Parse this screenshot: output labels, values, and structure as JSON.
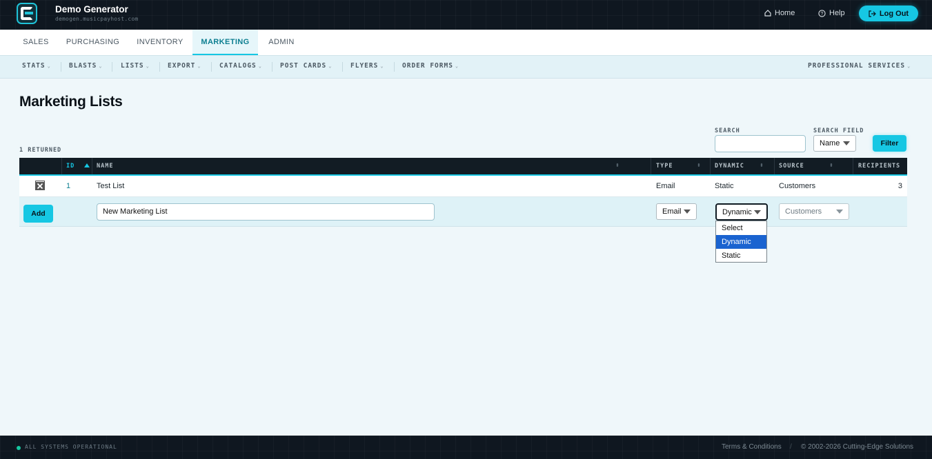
{
  "header": {
    "app_title": "Demo Generator",
    "app_subtitle": "demogen.musicpayhost.com",
    "home_label": "Home",
    "help_label": "Help",
    "logout_label": "Log Out"
  },
  "main_tabs": [
    "SALES",
    "PURCHASING",
    "INVENTORY",
    "MARKETING",
    "ADMIN"
  ],
  "active_tab": "MARKETING",
  "sub_nav": {
    "items": [
      "STATS",
      "BLASTS",
      "LISTS",
      "EXPORT",
      "CATALOGS",
      "POST CARDS",
      "FLYERS",
      "ORDER FORMS"
    ],
    "right_item": "PROFESSIONAL SERVICES"
  },
  "page": {
    "title": "Marketing Lists",
    "count_text": "1 RETURNED"
  },
  "filters": {
    "search_label": "SEARCH",
    "search_value": "",
    "search_field_label": "SEARCH FIELD",
    "search_field_value": "Name",
    "filter_button": "Filter"
  },
  "table": {
    "columns": [
      "ID",
      "NAME",
      "TYPE",
      "DYNAMIC",
      "SOURCE",
      "RECIPIENTS"
    ],
    "sorted_column": "ID",
    "rows": [
      {
        "id": "1",
        "name": "Test List",
        "type": "Email",
        "dynamic": "Static",
        "source": "Customers",
        "recipients": "3"
      }
    ],
    "new_row": {
      "add_button": "Add",
      "name_value": "New Marketing List",
      "type_value": "Email",
      "dynamic_value": "Dynamic",
      "source_value": "Customers"
    }
  },
  "dynamic_dropdown": {
    "options": [
      "Select",
      "Dynamic",
      "Static"
    ],
    "highlighted": "Dynamic"
  },
  "footer": {
    "status": "ALL SYSTEMS OPERATIONAL",
    "terms": "Terms & Conditions",
    "separator": "/",
    "copyright": "© 2002-2026 Cutting-Edge Solutions"
  },
  "colors": {
    "accent": "#16c7e3",
    "header_bg": "#0f1720",
    "page_bg": "#eff7fa",
    "highlight": "#1a63d0"
  }
}
